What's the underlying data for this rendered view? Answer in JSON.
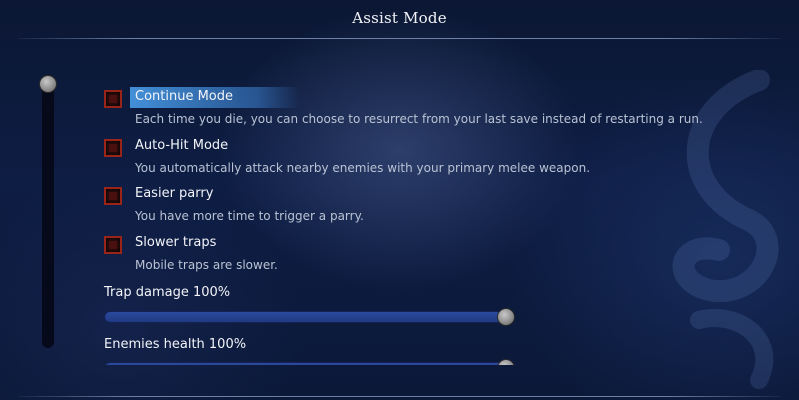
{
  "header": {
    "title": "Assist Mode"
  },
  "scrollbar": {
    "position": 0
  },
  "options": [
    {
      "label": "Continue Mode",
      "description": "Each time you die, you can choose to resurrect from your last save instead of restarting a run.",
      "checked": false,
      "focused": true
    },
    {
      "label": "Auto-Hit Mode",
      "description": "You automatically attack nearby enemies with your primary melee weapon.",
      "checked": false,
      "focused": false
    },
    {
      "label": "Easier parry",
      "description": "You have more time to trigger a parry.",
      "checked": false,
      "focused": false
    },
    {
      "label": "Slower traps",
      "description": "Mobile traps are slower.",
      "checked": false,
      "focused": false
    }
  ],
  "sliders": [
    {
      "label": "Trap damage 100%",
      "value": 1.0
    },
    {
      "label": "Enemies health 100%",
      "value": 1.0
    }
  ],
  "colors": {
    "focus_highlight": "#4696e1",
    "checkbox_border": "#9b2418",
    "slider_fill": "#2b4a9e",
    "background": "#0e1d44"
  }
}
